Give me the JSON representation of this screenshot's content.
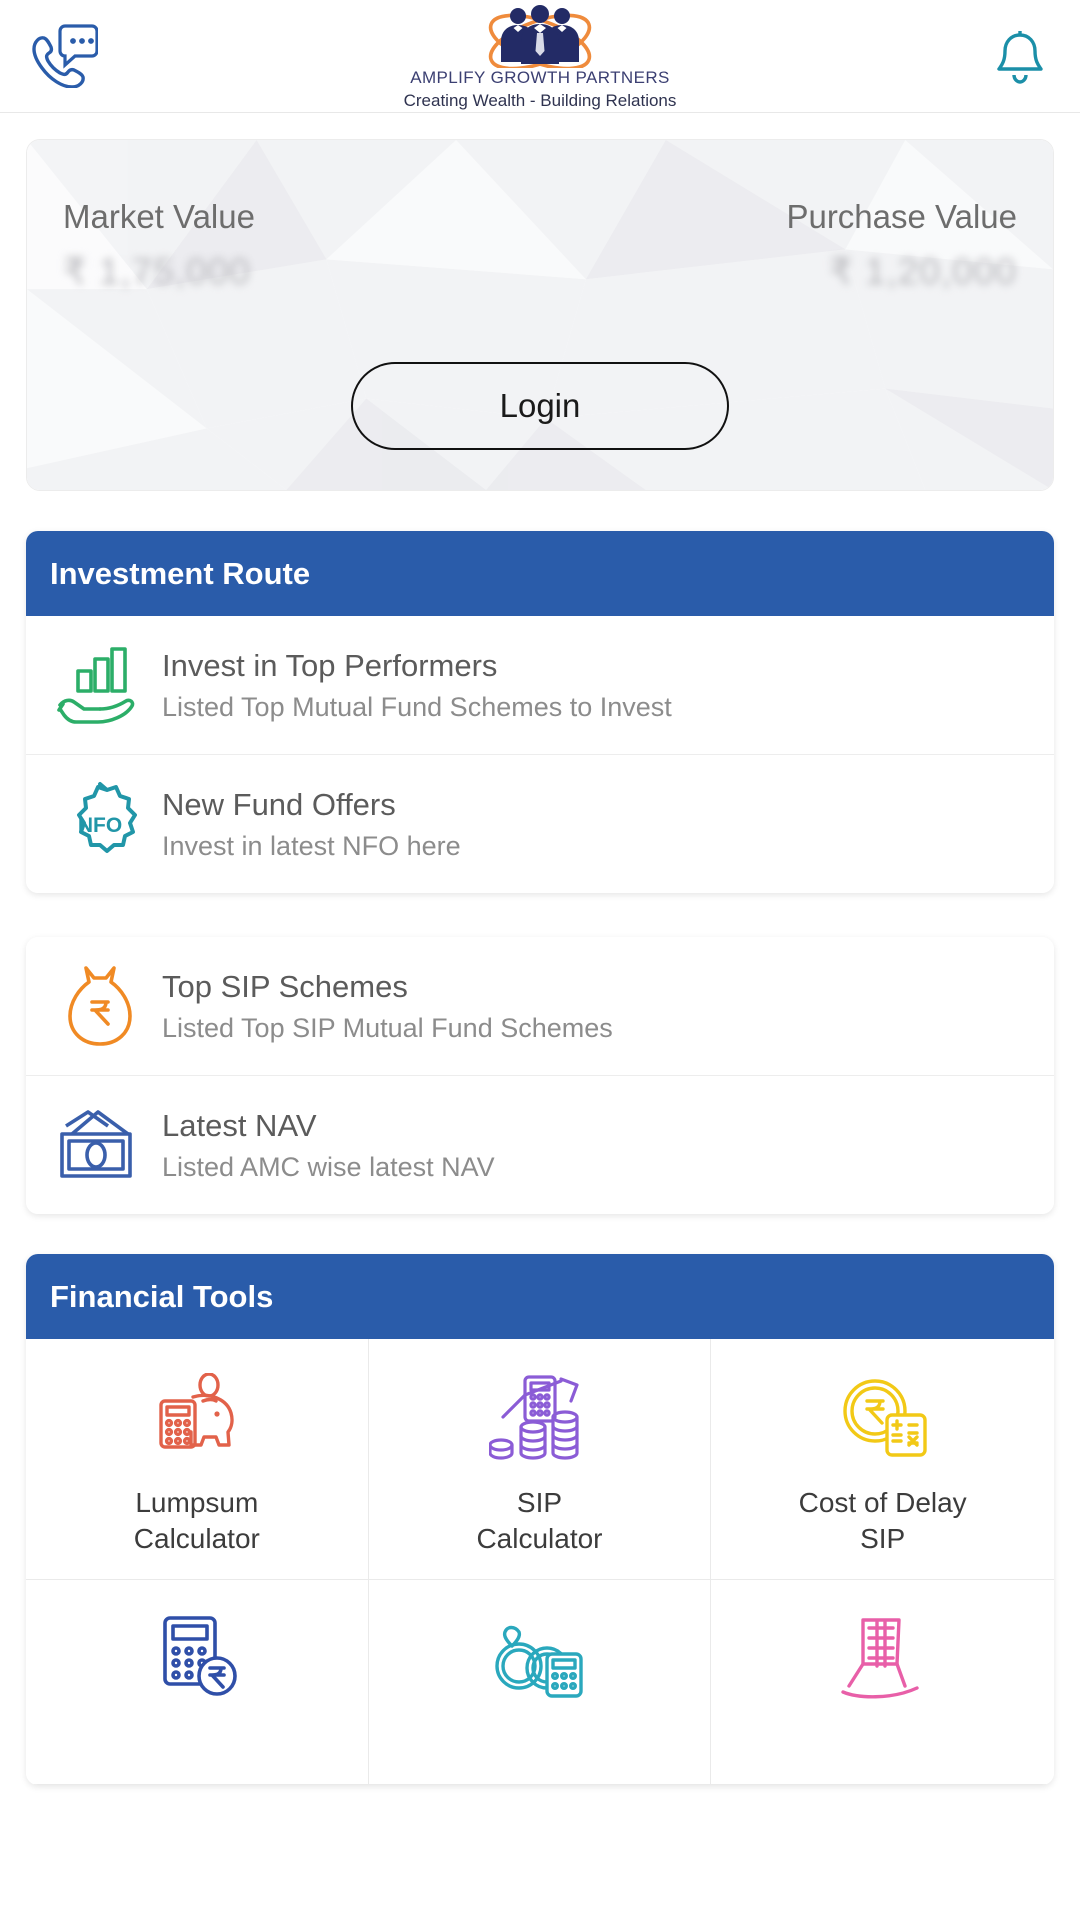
{
  "header": {
    "support_icon": "phone-chat-icon",
    "notification_icon": "bell-icon",
    "brand_name": "AMPLIFY GROWTH PARTNERS",
    "brand_tagline": "Creating Wealth - Building Relations",
    "logo_icon": "three-businessmen-atom-logo"
  },
  "portfolio": {
    "market_value_label": "Market Value",
    "market_value": "₹ 1,75,000",
    "purchase_value_label": "Purchase Value",
    "purchase_value": "₹ 1,20,000",
    "login_label": "Login"
  },
  "investment_route": {
    "title": "Investment Route",
    "items": [
      {
        "title": "Invest in Top Performers",
        "subtitle": "Listed Top Mutual Fund Schemes to Invest",
        "icon": "hand-bar-chart-icon",
        "color": "#2cae68"
      },
      {
        "title": "New Fund Offers",
        "subtitle": "Invest in latest NFO here",
        "icon": "nfo-badge-icon",
        "color": "#2196a8",
        "badge_text": "NFO"
      }
    ]
  },
  "secondary_routes": {
    "items": [
      {
        "title": "Top SIP Schemes",
        "subtitle": "Listed Top SIP Mutual Fund Schemes",
        "icon": "money-bag-rupee-icon",
        "color": "#f08a24"
      },
      {
        "title": "Latest NAV",
        "subtitle": "Listed AMC wise latest NAV",
        "icon": "banknotes-icon",
        "color": "#3a5fab"
      }
    ]
  },
  "financial_tools": {
    "title": "Financial Tools",
    "items": [
      {
        "label": "Lumpsum\nCalculator",
        "icon": "piggy-bank-calculator-icon",
        "color": "#e2624a"
      },
      {
        "label": "SIP\nCalculator",
        "icon": "calculator-coins-growth-icon",
        "color": "#8b5cd6"
      },
      {
        "label": "Cost of Delay\nSIP",
        "icon": "rupee-coin-calculator-icon",
        "color": "#f2c916"
      },
      {
        "label": "",
        "icon": "calculator-rupee-icon",
        "color": "#2f4fa8"
      },
      {
        "label": "",
        "icon": "wedding-rings-calculator-icon",
        "color": "#2aa8bd"
      },
      {
        "label": "",
        "icon": "rocking-chair-retirement-icon",
        "color": "#e85fa8"
      }
    ]
  },
  "theme": {
    "brand_blue": "#2a5caa",
    "page_bg": "#ffffff"
  }
}
